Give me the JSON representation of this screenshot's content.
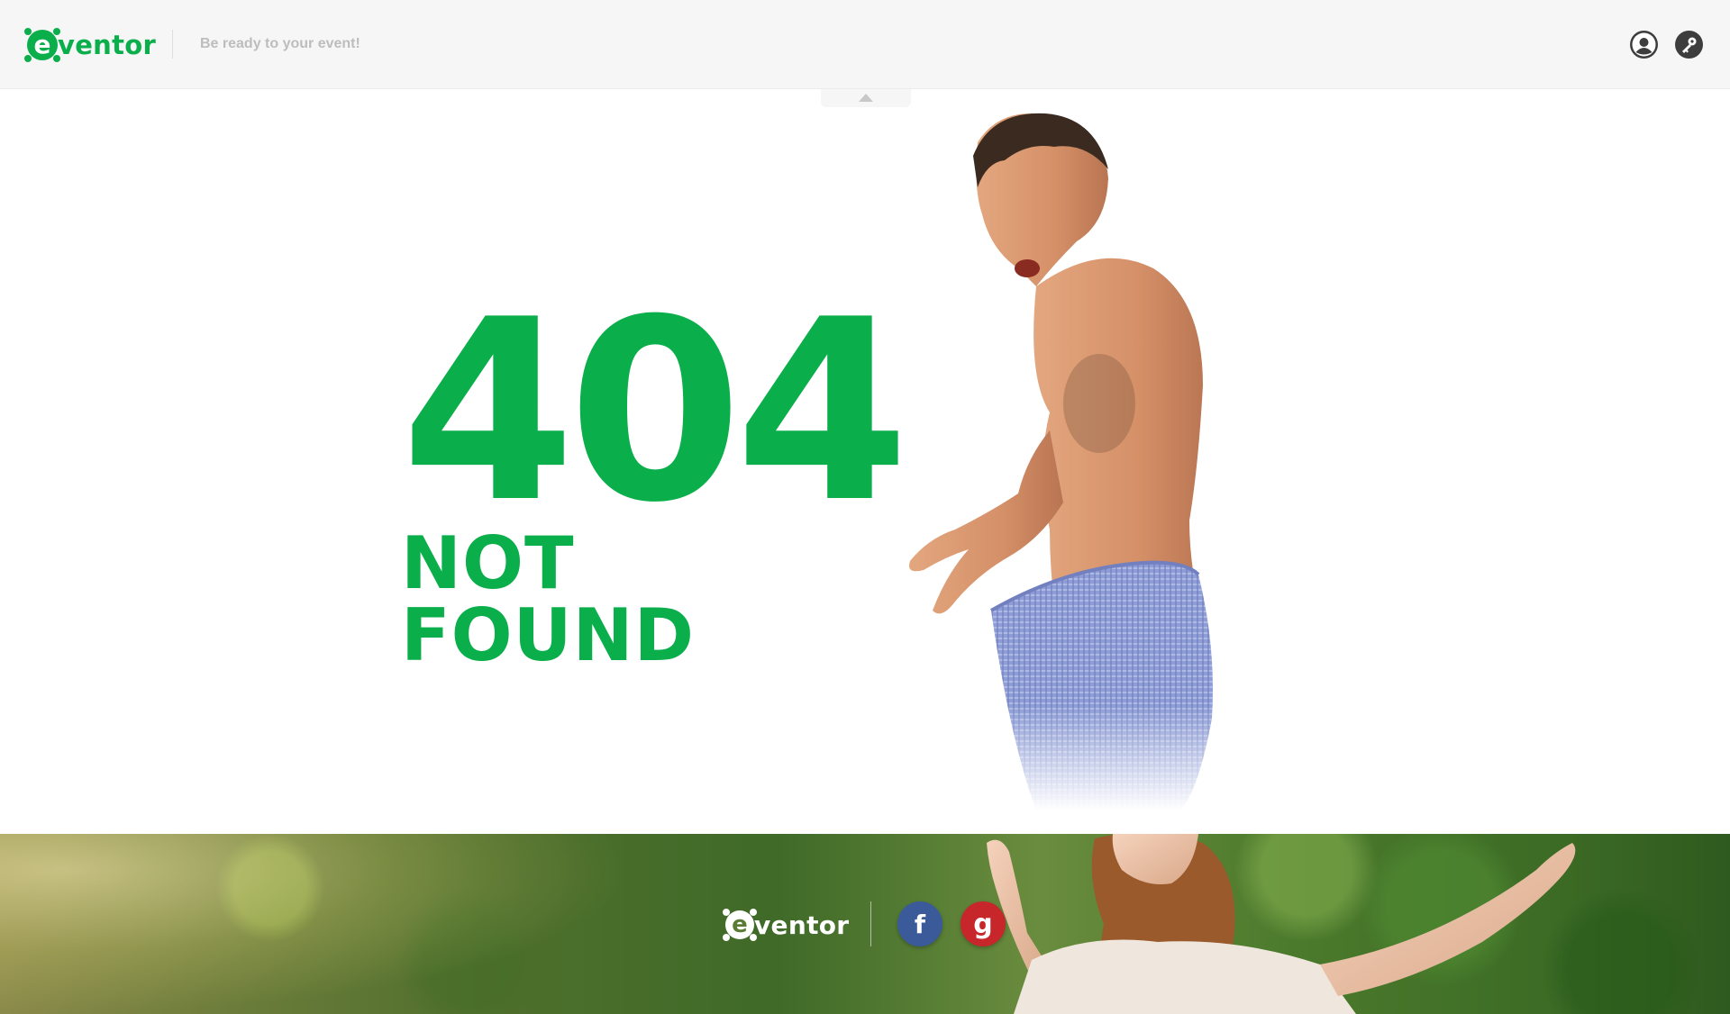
{
  "header": {
    "logo_letter": "e",
    "logo_text": "ventor",
    "tagline": "Be ready to your event!",
    "user_icon": "user-icon",
    "key_icon": "key-icon",
    "toggle_icon": "caret-up-icon"
  },
  "error": {
    "code": "404",
    "message": "NOT FOUND"
  },
  "footer": {
    "logo_letter": "e",
    "logo_text": "ventor",
    "social": [
      {
        "name": "facebook",
        "glyph": "f"
      },
      {
        "name": "google-plus",
        "glyph": "g"
      }
    ]
  },
  "colors": {
    "brand_green": "#0aae4a",
    "header_bg": "#f6f6f6",
    "facebook_blue": "#3b5a9a",
    "google_red": "#c7262b"
  }
}
